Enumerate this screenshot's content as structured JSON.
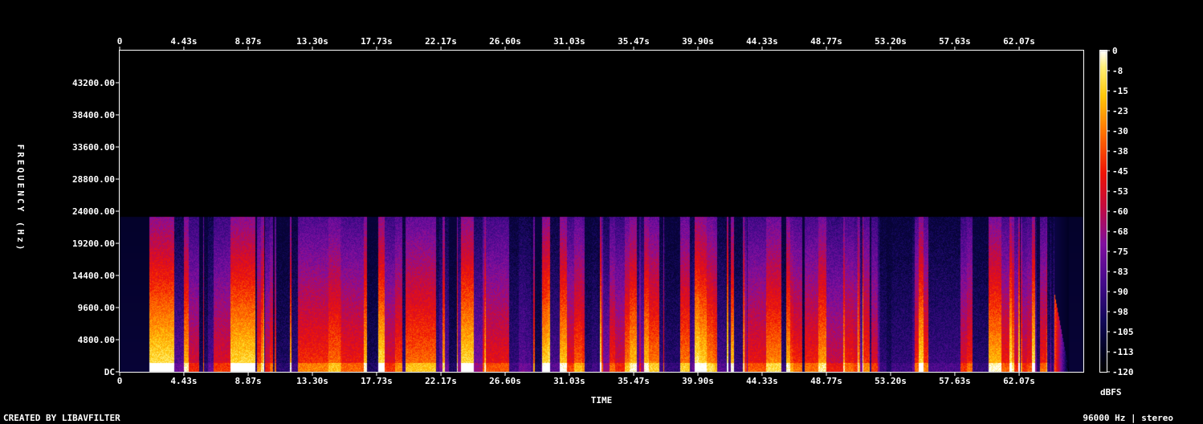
{
  "chart_data": {
    "type": "heatmap",
    "xlabel": "TIME",
    "ylabel": "FREQUENCY (Hz)",
    "x_ticks_top": [
      "0",
      "4.43s",
      "8.87s",
      "13.30s",
      "17.73s",
      "22.17s",
      "26.60s",
      "31.03s",
      "35.47s",
      "39.90s",
      "44.33s",
      "48.77s",
      "53.20s",
      "57.63s",
      "62.07s"
    ],
    "x_ticks_bottom": [
      "0",
      "4.43s",
      "8.87s",
      "13.30s",
      "17.73s",
      "22.17s",
      "26.60s",
      "31.03s",
      "35.47s",
      "39.90s",
      "44.33s",
      "48.77s",
      "53.20s",
      "57.63s",
      "62.07s"
    ],
    "x_tick_values": [
      0,
      4.43,
      8.87,
      13.3,
      17.73,
      22.17,
      26.6,
      31.03,
      35.47,
      39.9,
      44.33,
      48.77,
      53.2,
      57.63,
      62.07
    ],
    "xlim": [
      0,
      66.5
    ],
    "y_ticks": [
      "DC",
      "4800.00",
      "9600.00",
      "14400.00",
      "19200.00",
      "24000.00",
      "28800.00",
      "33600.00",
      "38400.00",
      "43200.00"
    ],
    "y_tick_values": [
      0,
      4800,
      9600,
      14400,
      19200,
      24000,
      28800,
      33600,
      38400,
      43200
    ],
    "ylim": [
      0,
      48000
    ],
    "colorbar": {
      "label": "dBFS",
      "ticks": [
        "0",
        "-8",
        "-15",
        "-23",
        "-30",
        "-38",
        "-45",
        "-53",
        "-60",
        "-68",
        "-75",
        "-83",
        "-90",
        "-98",
        "-105",
        "-113",
        "-120"
      ],
      "range": [
        -120,
        0
      ]
    },
    "signal": {
      "start_time": 2.0,
      "end_time": 64.5,
      "tail_end_time": 65.5,
      "max_freq": 23200,
      "noise_floor_max_freq": 23200
    }
  },
  "footer": {
    "left": "CREATED BY LIBAVFILTER",
    "right": "96000 Hz | stereo"
  }
}
